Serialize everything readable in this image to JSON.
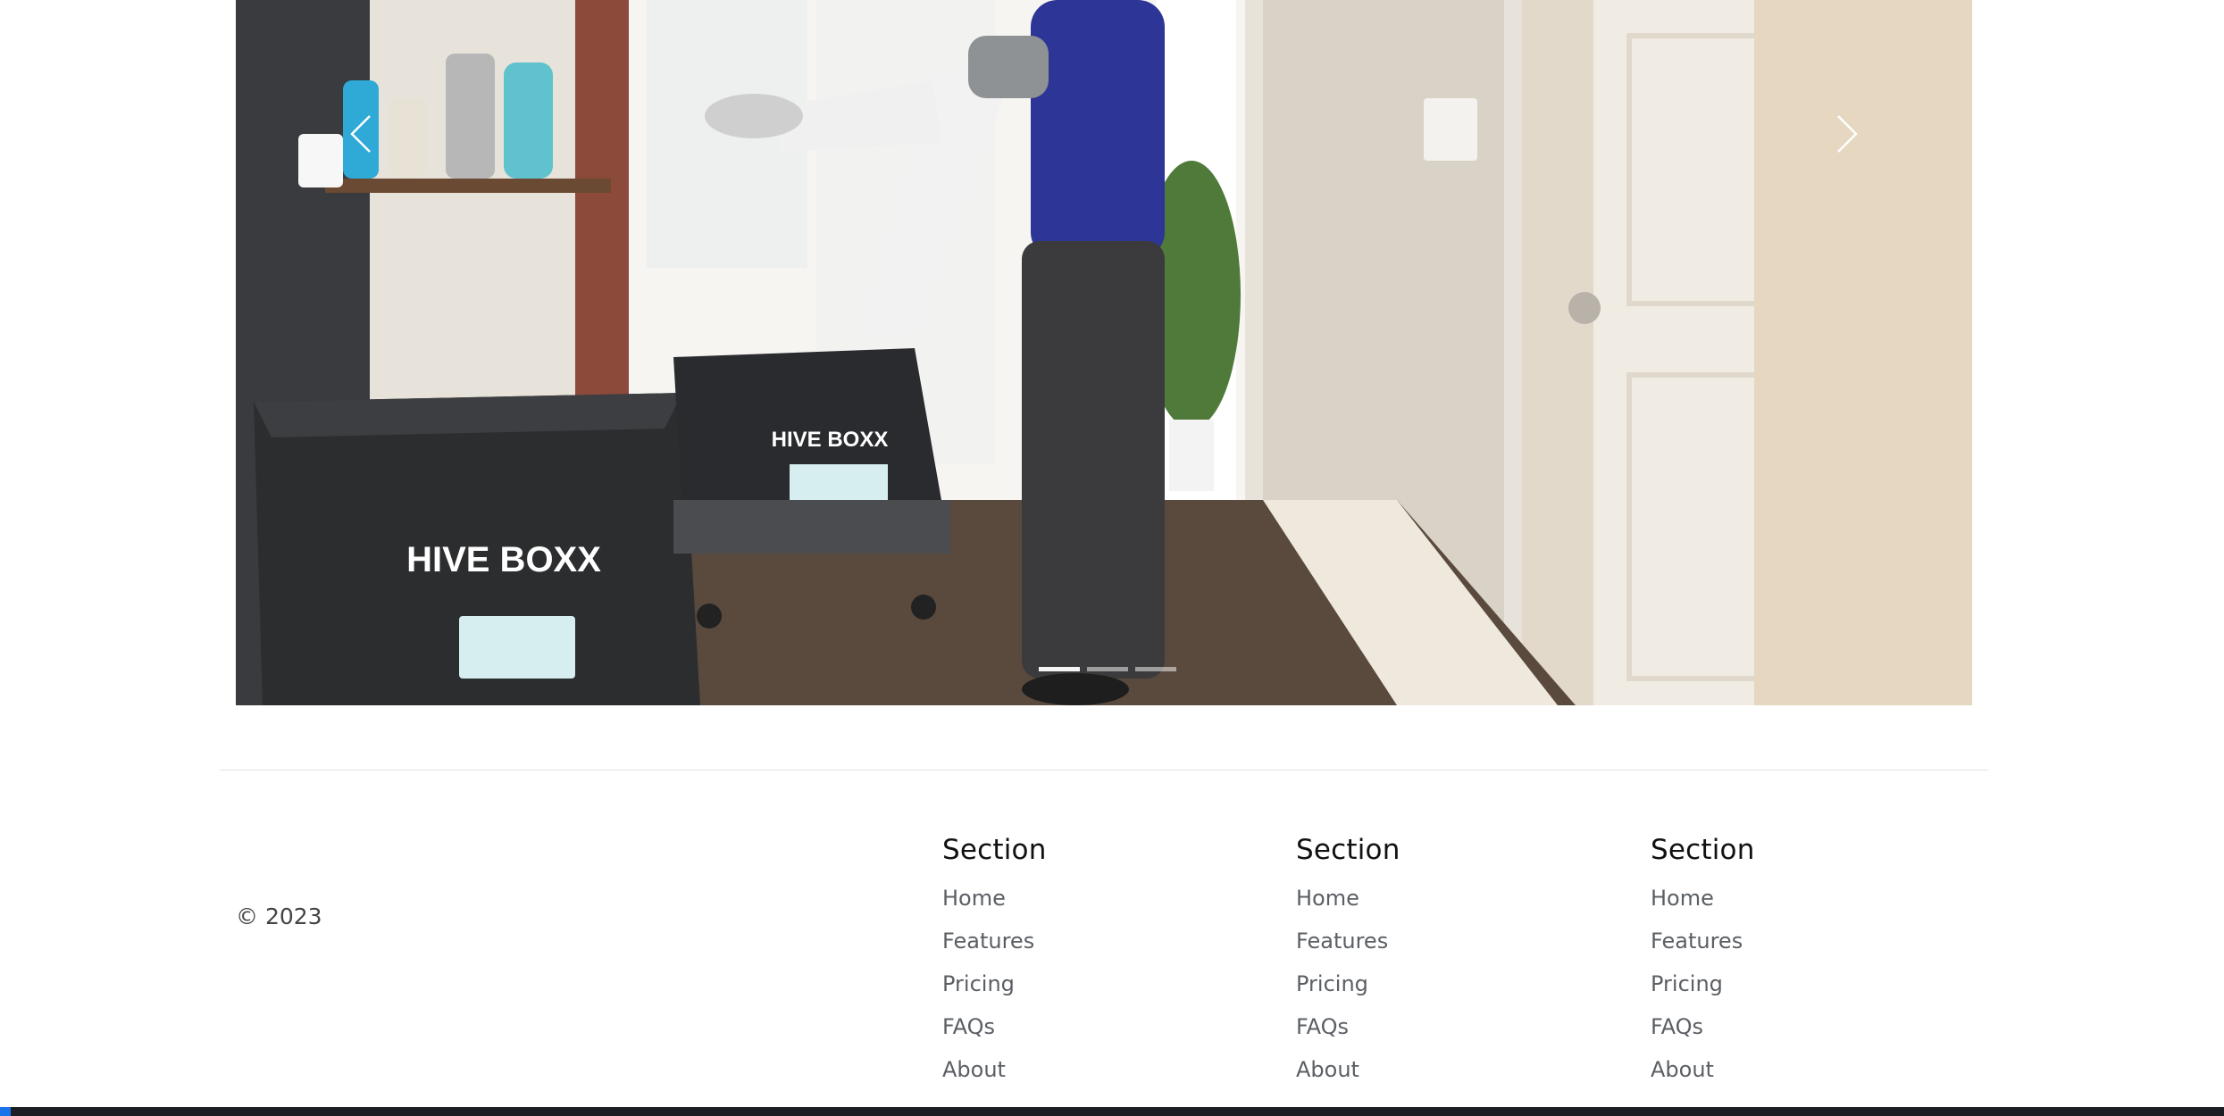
{
  "carousel": {
    "prev_icon": "chevron-left-icon",
    "next_icon": "chevron-right-icon",
    "slides": 3,
    "active_slide": 1,
    "box_brand_large": "HIVE BOXX",
    "box_brand_small": "HIVE BOXX"
  },
  "footer": {
    "copyright": "© 2023",
    "columns": [
      {
        "title": "Section",
        "links": [
          "Home",
          "Features",
          "Pricing",
          "FAQs",
          "About"
        ]
      },
      {
        "title": "Section",
        "links": [
          "Home",
          "Features",
          "Pricing",
          "FAQs",
          "About"
        ]
      },
      {
        "title": "Section",
        "links": [
          "Home",
          "Features",
          "Pricing",
          "FAQs",
          "About"
        ]
      }
    ]
  },
  "colors": {
    "heading": "#111111",
    "link": "#5b5f64",
    "divider": "#dee2e6",
    "taskbar": "#1b1e22",
    "taskbar_accent": "#1a73e8"
  }
}
